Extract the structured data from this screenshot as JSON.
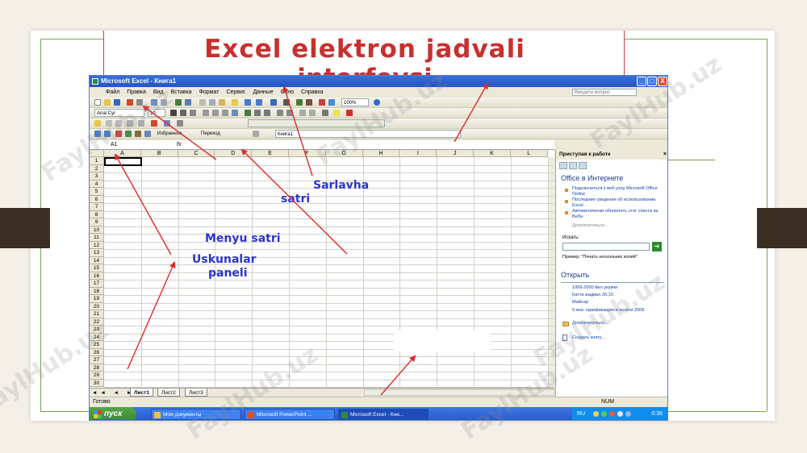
{
  "slide": {
    "title_line1": "Excel elektron jadvali",
    "title_line2": "interfeysi"
  },
  "annotations": {
    "sarlavha": "Sarlavha",
    "satri": "satri",
    "menyu": "Menyu satri",
    "uskunalar": "Uskunalar",
    "paneli": "paneli"
  },
  "watermark": "FaylHub.uz",
  "excel": {
    "title": "Microsoft Excel - Книга1",
    "window_buttons": [
      "_",
      "□",
      "X"
    ],
    "menu": [
      "Файл",
      "Правка",
      "Вид",
      "Вставка",
      "Формат",
      "Сервис",
      "Данные",
      "Окно",
      "Справка"
    ],
    "ask_placeholder": "Введите вопрос",
    "toolbar": {
      "font": "Arial Cyr",
      "size": "10",
      "zoom": "100%",
      "favorites": "Избранное",
      "goto": "Переход",
      "doc": "Книга1"
    },
    "namebox": "A1",
    "fx": "fx",
    "columns": [
      "A",
      "B",
      "C",
      "D",
      "E",
      "F",
      "G",
      "H",
      "I",
      "J",
      "K",
      "L"
    ],
    "rows": [
      "1",
      "2",
      "3",
      "4",
      "5",
      "6",
      "7",
      "8",
      "9",
      "10",
      "11",
      "12",
      "13",
      "14",
      "15",
      "16",
      "17",
      "18",
      "19",
      "20",
      "21",
      "22",
      "23",
      "24",
      "25",
      "26",
      "27",
      "28",
      "29",
      "30"
    ],
    "sheet_tabs": [
      "Лист1",
      "Лист2",
      "Лист3"
    ],
    "tab_nav": "◄◄ ◄ ► ►►",
    "status_left": "Готово",
    "status_num": "NUM"
  },
  "task_pane": {
    "header": "Приступая к работе",
    "close": "×",
    "section_online": "Office в Интернете",
    "links": [
      "Подключиться к веб-узлу Microsoft Office Online",
      "Последние сведения об использовании Excel",
      "Автоматически обновлять этот список из Веба"
    ],
    "more": "Дополнительно...",
    "search_label": "Искать:",
    "example": "Пример: \"Печать нескольких копий\"",
    "section_open": "Открыть",
    "recent": [
      "1999-2000 йил укувчи",
      "Катта жадвал 26,10",
      "Майсар",
      "5-жас тарификацияси янгиси 2006"
    ],
    "more_files": "Дополнительно...",
    "create": "Создать книгу..."
  },
  "taskbar": {
    "start": "пуск",
    "items": [
      "Мои документы",
      "Microsoft PowerPoint ...",
      "Microsoft Excel - Кни..."
    ],
    "lang": "RU",
    "clock": "0:36"
  },
  "colors": {
    "title_red": "#c8302e",
    "annotation_blue": "#2b33d6",
    "arrow_red": "#e02a2a",
    "frame_green": "#7aa24a"
  }
}
